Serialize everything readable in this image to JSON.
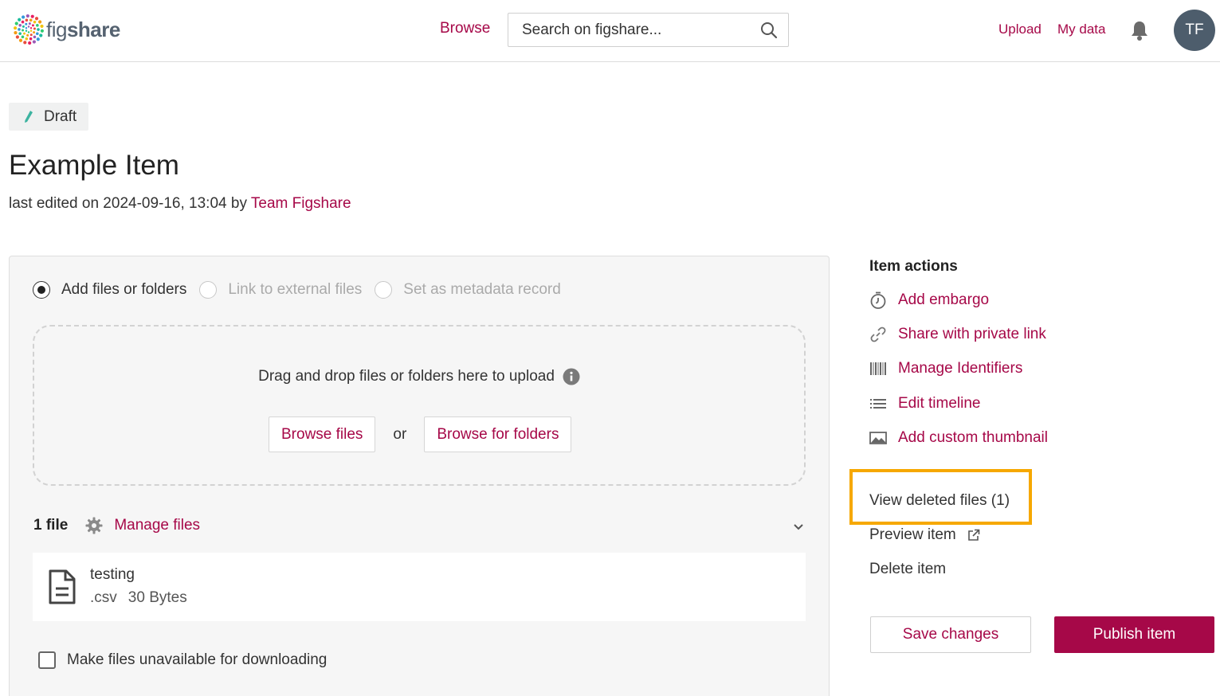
{
  "header": {
    "logo_text_light": "fig",
    "logo_text_bold": "share",
    "browse_label": "Browse",
    "search_placeholder": "Search on figshare...",
    "upload_label": "Upload",
    "my_data_label": "My data",
    "avatar_initials": "TF"
  },
  "item": {
    "status": "Draft",
    "title": "Example Item",
    "last_edited_prefix": "last edited on 2024-09-16, 13:04 by",
    "editor": "Team Figshare"
  },
  "upload": {
    "options": [
      {
        "label": "Add files or folders",
        "selected": true,
        "enabled": true
      },
      {
        "label": "Link to external files",
        "selected": false,
        "enabled": false
      },
      {
        "label": "Set as metadata record",
        "selected": false,
        "enabled": false
      }
    ],
    "drop_text": "Drag and drop files or folders here to upload",
    "browse_files_label": "Browse files",
    "or_label": "or",
    "browse_folders_label": "Browse for folders"
  },
  "files": {
    "count_label": "1 file",
    "manage_label": "Manage files",
    "items": [
      {
        "name": "testing",
        "extension": ".csv",
        "size": "30 Bytes"
      }
    ],
    "unavailable_label": "Make files unavailable for downloading"
  },
  "sidebar": {
    "title": "Item actions",
    "actions": [
      {
        "label": "Add embargo",
        "icon": "stopwatch-icon"
      },
      {
        "label": "Share with private link",
        "icon": "link-icon"
      },
      {
        "label": "Manage Identifiers",
        "icon": "barcode-icon"
      },
      {
        "label": "Edit timeline",
        "icon": "list-icon"
      },
      {
        "label": "Add custom thumbnail",
        "icon": "image-icon"
      }
    ],
    "view_deleted_label": "View deleted files (1)",
    "preview_label": "Preview item",
    "delete_label": "Delete item",
    "save_label": "Save changes",
    "publish_label": "Publish item"
  },
  "colors": {
    "accent": "#a60848",
    "highlight": "#f6a800",
    "avatar_bg": "#4d5d6c"
  }
}
